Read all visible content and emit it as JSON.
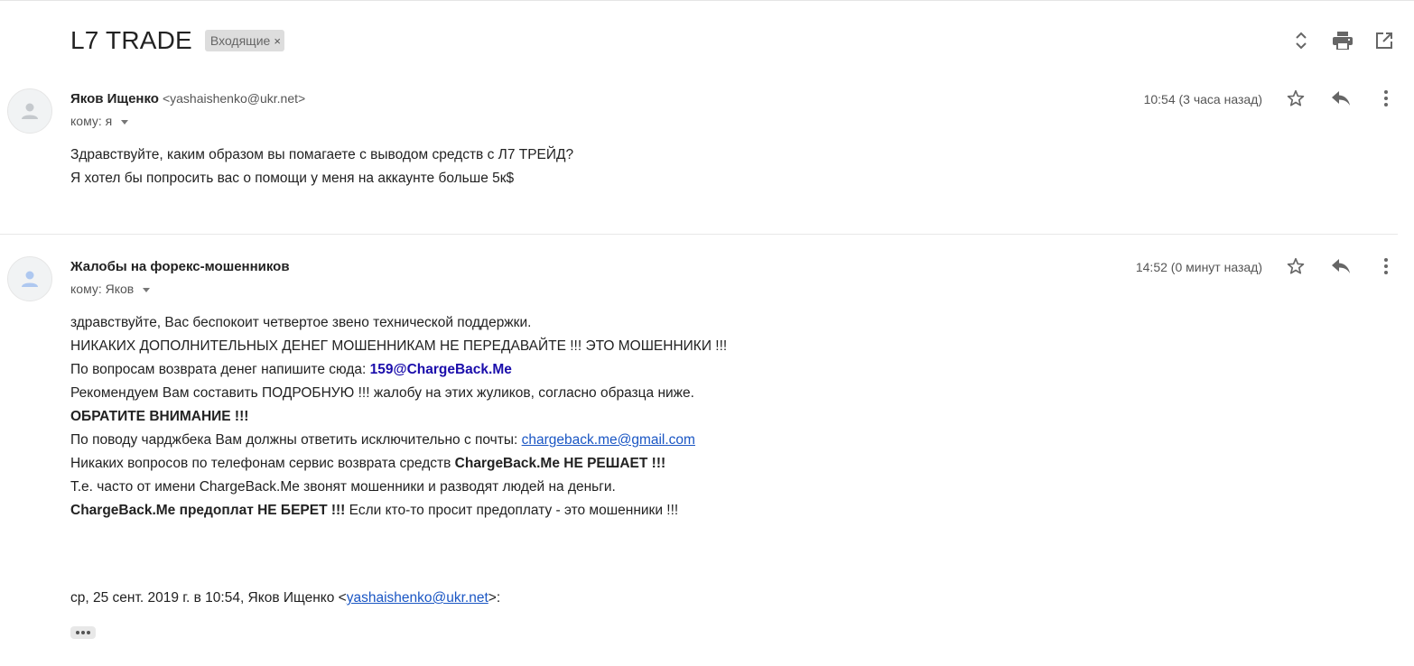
{
  "thread": {
    "title": "L7 TRADE",
    "label": "Входящие",
    "label_close": "×",
    "actions": [
      {
        "icon": "expand-collapse-icon"
      },
      {
        "icon": "print-icon"
      },
      {
        "icon": "open-in-new-window-icon"
      }
    ]
  },
  "messages": [
    {
      "sender_name": "Яков Ищенко",
      "sender_email": "<yashaishenko@ukr.net>",
      "recipient": "кому: я",
      "timestamp": "10:54 (3 часа назад)",
      "body": [
        "Здравствуйте, каким образом вы помагаете с выводом средств с Л7 ТРЕЙД?",
        "Я хотел бы попросить вас о помощи у меня на аккаунте больше 5к$"
      ]
    },
    {
      "sender_name": "Жалобы на форекс-мошенников",
      "recipient": "кому: Яков",
      "timestamp": "14:52 (0 минут назад)",
      "body": {
        "line1": "здравствуйте, Вас беспокоит четвертое звено технической поддержки.",
        "line2": "НИКАКИХ ДОПОЛНИТЕЛЬНЫХ ДЕНЕГ МОШЕННИКАМ НЕ ПЕРЕДАВАЙТЕ !!! ЭТО МОШЕННИКИ !!!",
        "line3_text": "По вопросам возврата денег напишите сюда: ",
        "line3_link": "159@ChargeBack.Me",
        "line4": "Рекомендуем Вам составить ПОДРОБНУЮ !!! жалобу на этих жуликов, согласно образца ниже.",
        "line5": "ОБРАТИТЕ ВНИМАНИЕ !!!",
        "line6_text": "По поводу чарджбека Вам должны ответить исключительно с почты: ",
        "line6_link": "chargeback.me@gmail.com",
        "line7_text": "Никаких вопросов по телефонам сервис возврата средств ",
        "line7_bold": "ChargeBack.Me НЕ РЕШАЕТ !!!",
        "line8": "Т.е. часто от имени ChargeBack.Me звонят мошенники и разводят людей на деньги.",
        "line9_bold": "ChargeBack.Me предоплат НЕ БЕРЕТ !!!",
        "line9_text": " Если кто-то просит предоплату - это мошенники !!!"
      },
      "quote_prefix": "ср, 25 сент. 2019 г. в 10:54, Яков Ищенко <",
      "quote_email": "yashaishenko@ukr.net",
      "quote_suffix": ">:"
    }
  ],
  "colors": {
    "link_bold": "#1a0dab",
    "link": "#1a56c4",
    "chip_bg": "#dddddd"
  }
}
